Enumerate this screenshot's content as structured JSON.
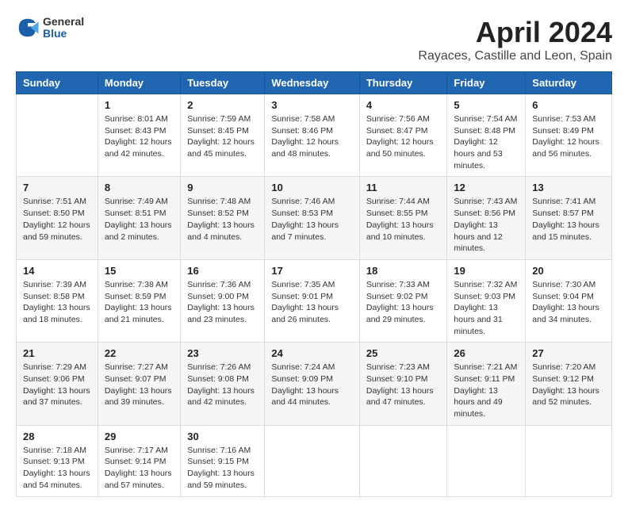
{
  "header": {
    "logo_general": "General",
    "logo_blue": "Blue",
    "main_title": "April 2024",
    "subtitle": "Rayaces, Castille and Leon, Spain"
  },
  "weekdays": [
    "Sunday",
    "Monday",
    "Tuesday",
    "Wednesday",
    "Thursday",
    "Friday",
    "Saturday"
  ],
  "weeks": [
    [
      {
        "day": "",
        "sunrise": "",
        "sunset": "",
        "daylight": ""
      },
      {
        "day": "1",
        "sunrise": "Sunrise: 8:01 AM",
        "sunset": "Sunset: 8:43 PM",
        "daylight": "Daylight: 12 hours and 42 minutes."
      },
      {
        "day": "2",
        "sunrise": "Sunrise: 7:59 AM",
        "sunset": "Sunset: 8:45 PM",
        "daylight": "Daylight: 12 hours and 45 minutes."
      },
      {
        "day": "3",
        "sunrise": "Sunrise: 7:58 AM",
        "sunset": "Sunset: 8:46 PM",
        "daylight": "Daylight: 12 hours and 48 minutes."
      },
      {
        "day": "4",
        "sunrise": "Sunrise: 7:56 AM",
        "sunset": "Sunset: 8:47 PM",
        "daylight": "Daylight: 12 hours and 50 minutes."
      },
      {
        "day": "5",
        "sunrise": "Sunrise: 7:54 AM",
        "sunset": "Sunset: 8:48 PM",
        "daylight": "Daylight: 12 hours and 53 minutes."
      },
      {
        "day": "6",
        "sunrise": "Sunrise: 7:53 AM",
        "sunset": "Sunset: 8:49 PM",
        "daylight": "Daylight: 12 hours and 56 minutes."
      }
    ],
    [
      {
        "day": "7",
        "sunrise": "Sunrise: 7:51 AM",
        "sunset": "Sunset: 8:50 PM",
        "daylight": "Daylight: 12 hours and 59 minutes."
      },
      {
        "day": "8",
        "sunrise": "Sunrise: 7:49 AM",
        "sunset": "Sunset: 8:51 PM",
        "daylight": "Daylight: 13 hours and 2 minutes."
      },
      {
        "day": "9",
        "sunrise": "Sunrise: 7:48 AM",
        "sunset": "Sunset: 8:52 PM",
        "daylight": "Daylight: 13 hours and 4 minutes."
      },
      {
        "day": "10",
        "sunrise": "Sunrise: 7:46 AM",
        "sunset": "Sunset: 8:53 PM",
        "daylight": "Daylight: 13 hours and 7 minutes."
      },
      {
        "day": "11",
        "sunrise": "Sunrise: 7:44 AM",
        "sunset": "Sunset: 8:55 PM",
        "daylight": "Daylight: 13 hours and 10 minutes."
      },
      {
        "day": "12",
        "sunrise": "Sunrise: 7:43 AM",
        "sunset": "Sunset: 8:56 PM",
        "daylight": "Daylight: 13 hours and 12 minutes."
      },
      {
        "day": "13",
        "sunrise": "Sunrise: 7:41 AM",
        "sunset": "Sunset: 8:57 PM",
        "daylight": "Daylight: 13 hours and 15 minutes."
      }
    ],
    [
      {
        "day": "14",
        "sunrise": "Sunrise: 7:39 AM",
        "sunset": "Sunset: 8:58 PM",
        "daylight": "Daylight: 13 hours and 18 minutes."
      },
      {
        "day": "15",
        "sunrise": "Sunrise: 7:38 AM",
        "sunset": "Sunset: 8:59 PM",
        "daylight": "Daylight: 13 hours and 21 minutes."
      },
      {
        "day": "16",
        "sunrise": "Sunrise: 7:36 AM",
        "sunset": "Sunset: 9:00 PM",
        "daylight": "Daylight: 13 hours and 23 minutes."
      },
      {
        "day": "17",
        "sunrise": "Sunrise: 7:35 AM",
        "sunset": "Sunset: 9:01 PM",
        "daylight": "Daylight: 13 hours and 26 minutes."
      },
      {
        "day": "18",
        "sunrise": "Sunrise: 7:33 AM",
        "sunset": "Sunset: 9:02 PM",
        "daylight": "Daylight: 13 hours and 29 minutes."
      },
      {
        "day": "19",
        "sunrise": "Sunrise: 7:32 AM",
        "sunset": "Sunset: 9:03 PM",
        "daylight": "Daylight: 13 hours and 31 minutes."
      },
      {
        "day": "20",
        "sunrise": "Sunrise: 7:30 AM",
        "sunset": "Sunset: 9:04 PM",
        "daylight": "Daylight: 13 hours and 34 minutes."
      }
    ],
    [
      {
        "day": "21",
        "sunrise": "Sunrise: 7:29 AM",
        "sunset": "Sunset: 9:06 PM",
        "daylight": "Daylight: 13 hours and 37 minutes."
      },
      {
        "day": "22",
        "sunrise": "Sunrise: 7:27 AM",
        "sunset": "Sunset: 9:07 PM",
        "daylight": "Daylight: 13 hours and 39 minutes."
      },
      {
        "day": "23",
        "sunrise": "Sunrise: 7:26 AM",
        "sunset": "Sunset: 9:08 PM",
        "daylight": "Daylight: 13 hours and 42 minutes."
      },
      {
        "day": "24",
        "sunrise": "Sunrise: 7:24 AM",
        "sunset": "Sunset: 9:09 PM",
        "daylight": "Daylight: 13 hours and 44 minutes."
      },
      {
        "day": "25",
        "sunrise": "Sunrise: 7:23 AM",
        "sunset": "Sunset: 9:10 PM",
        "daylight": "Daylight: 13 hours and 47 minutes."
      },
      {
        "day": "26",
        "sunrise": "Sunrise: 7:21 AM",
        "sunset": "Sunset: 9:11 PM",
        "daylight": "Daylight: 13 hours and 49 minutes."
      },
      {
        "day": "27",
        "sunrise": "Sunrise: 7:20 AM",
        "sunset": "Sunset: 9:12 PM",
        "daylight": "Daylight: 13 hours and 52 minutes."
      }
    ],
    [
      {
        "day": "28",
        "sunrise": "Sunrise: 7:18 AM",
        "sunset": "Sunset: 9:13 PM",
        "daylight": "Daylight: 13 hours and 54 minutes."
      },
      {
        "day": "29",
        "sunrise": "Sunrise: 7:17 AM",
        "sunset": "Sunset: 9:14 PM",
        "daylight": "Daylight: 13 hours and 57 minutes."
      },
      {
        "day": "30",
        "sunrise": "Sunrise: 7:16 AM",
        "sunset": "Sunset: 9:15 PM",
        "daylight": "Daylight: 13 hours and 59 minutes."
      },
      {
        "day": "",
        "sunrise": "",
        "sunset": "",
        "daylight": ""
      },
      {
        "day": "",
        "sunrise": "",
        "sunset": "",
        "daylight": ""
      },
      {
        "day": "",
        "sunrise": "",
        "sunset": "",
        "daylight": ""
      },
      {
        "day": "",
        "sunrise": "",
        "sunset": "",
        "daylight": ""
      }
    ]
  ]
}
